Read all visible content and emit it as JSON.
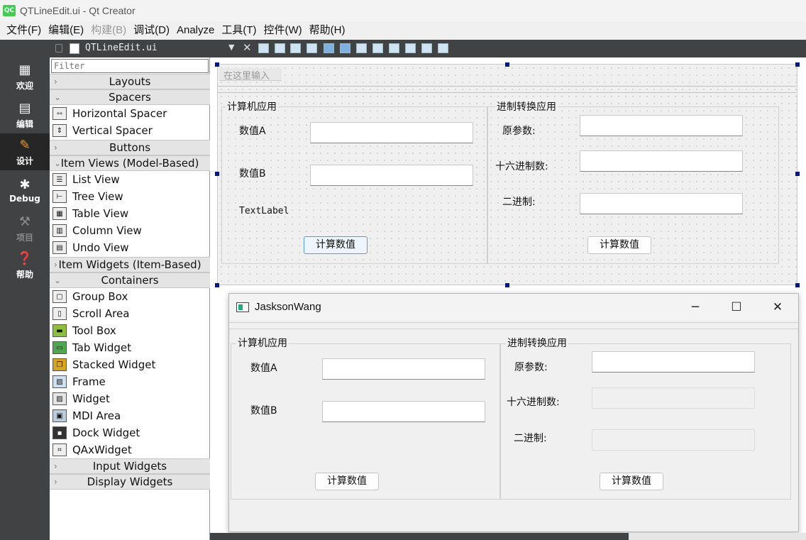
{
  "window": {
    "title": "QTLineEdit.ui - Qt Creator",
    "app_icon": "QC"
  },
  "menu": [
    {
      "label": "文件(F)",
      "enabled": true
    },
    {
      "label": "编辑(E)",
      "enabled": true
    },
    {
      "label": "构建(B)",
      "enabled": false
    },
    {
      "label": "调试(D)",
      "enabled": true
    },
    {
      "label": "Analyze",
      "enabled": true
    },
    {
      "label": "工具(T)",
      "enabled": true
    },
    {
      "label": "控件(W)",
      "enabled": true
    },
    {
      "label": "帮助(H)",
      "enabled": true
    }
  ],
  "modes": [
    {
      "label": "欢迎",
      "icon": "grid-icon",
      "active": false
    },
    {
      "label": "编辑",
      "icon": "edit-doc-icon",
      "active": false
    },
    {
      "label": "设计",
      "icon": "pencil-icon",
      "active": true
    },
    {
      "label": "Debug",
      "icon": "bug-icon",
      "active": false
    },
    {
      "label": "项目",
      "icon": "wrench-icon",
      "active": false,
      "disabled": true
    },
    {
      "label": "帮助",
      "icon": "help-icon",
      "active": false
    }
  ],
  "doc": {
    "file_name": "QTLineEdit.ui"
  },
  "widgetbox": {
    "filter_placeholder": "Filter",
    "categories": {
      "layouts": "Layouts",
      "spacers": "Spacers",
      "buttons": "Buttons",
      "item_views": "Item Views (Model-Based)",
      "item_widgets": "Item Widgets (Item-Based)",
      "containers": "Containers",
      "input_widgets": "Input Widgets",
      "display_widgets": "Display Widgets"
    },
    "spacers": [
      "Horizontal Spacer",
      "Vertical Spacer"
    ],
    "item_views": [
      "List View",
      "Tree View",
      "Table View",
      "Column View",
      "Undo View"
    ],
    "containers": [
      "Group Box",
      "Scroll Area",
      "Tool Box",
      "Tab Widget",
      "Stacked Widget",
      "Frame",
      "Widget",
      "MDI Area",
      "Dock Widget",
      "QAxWidget"
    ]
  },
  "form": {
    "top_edit_placeholder": "在这里输入",
    "calc_group": {
      "title": "计算机应用",
      "label_a": "数值A",
      "label_b": "数值B",
      "text_label": "TextLabel",
      "button": "计算数值"
    },
    "convert_group": {
      "title": "进制转换应用",
      "label_src": "原参数:",
      "label_hex": "十六进制数:",
      "label_bin": "二进制:",
      "button": "计算数值"
    }
  },
  "preview": {
    "title": "JasksonWang",
    "minimize": "─",
    "maximize": "☐",
    "close": "✕",
    "calc_group": {
      "title": "计算机应用",
      "label_a": "数值A",
      "label_b": "数值B",
      "button": "计算数值"
    },
    "convert_group": {
      "title": "进制转换应用",
      "label_src": "原参数:",
      "label_hex": "十六进制数:",
      "label_bin": "二进制:",
      "button": "计算数值"
    }
  }
}
